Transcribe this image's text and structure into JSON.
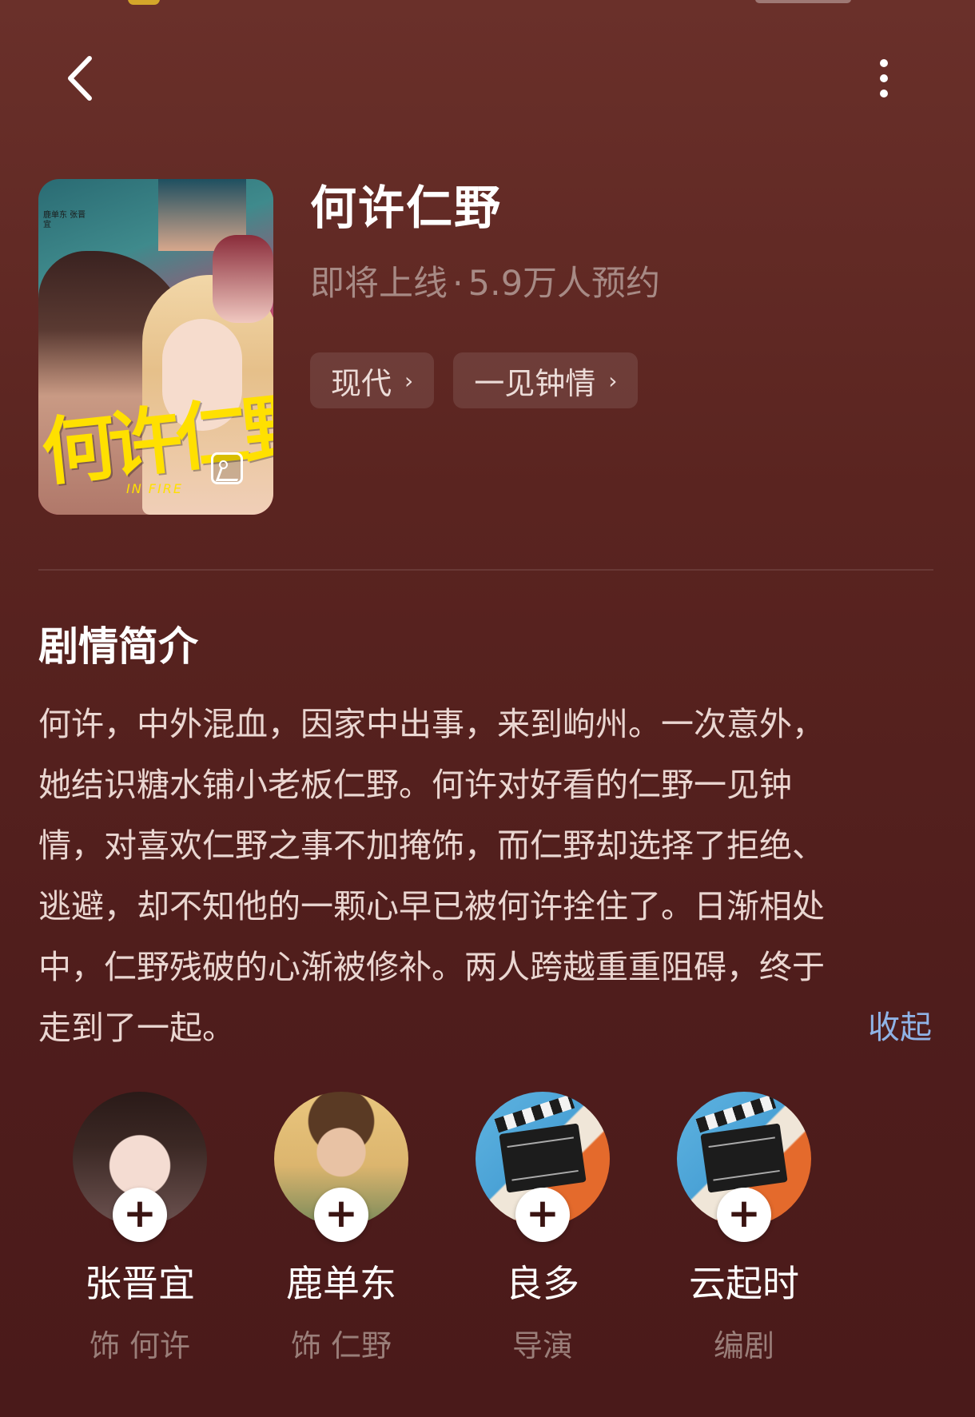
{
  "show": {
    "title": "何许仁野",
    "status": "即将上线",
    "reservations": "5.9万人预约",
    "tags": [
      "现代",
      "一见钟情"
    ],
    "poster": {
      "title_art": "何许仁野",
      "subtitle_art": "IN FIRE",
      "credits": "鹿单东 张晋宜"
    }
  },
  "synopsis": {
    "heading": "剧情简介",
    "lines": [
      "何许，中外混血，因家中出事，来到岣州。一次意外，",
      "她结识糖水铺小老板仁野。何许对好看的仁野一见钟",
      "情，对喜欢仁野之事不加掩饰，而仁野却选择了拒绝、",
      "逃避，却不知他的一颗心早已被何许拴住了。日渐相处",
      "中，仁野残破的心渐被修补。两人跨越重重阻碍，终于",
      "走到了一起。"
    ],
    "collapse_label": "收起"
  },
  "people": [
    {
      "name": "张晋宜",
      "role": "饰 何许",
      "avatar": "woman-portrait"
    },
    {
      "name": "鹿单东",
      "role": "饰 仁野",
      "avatar": "man-portrait"
    },
    {
      "name": "良多",
      "role": "导演",
      "avatar": "clapperboard"
    },
    {
      "name": "云起时",
      "role": "编剧",
      "avatar": "clapperboard"
    }
  ],
  "icons": {
    "back": "chevron-left-icon",
    "more": "more-vertical-icon",
    "follow": "plus-icon",
    "gallery": "image-gallery-icon"
  },
  "colors": {
    "background": "#5a2420",
    "link": "#8fb3e6",
    "muted": "#a78a85"
  }
}
